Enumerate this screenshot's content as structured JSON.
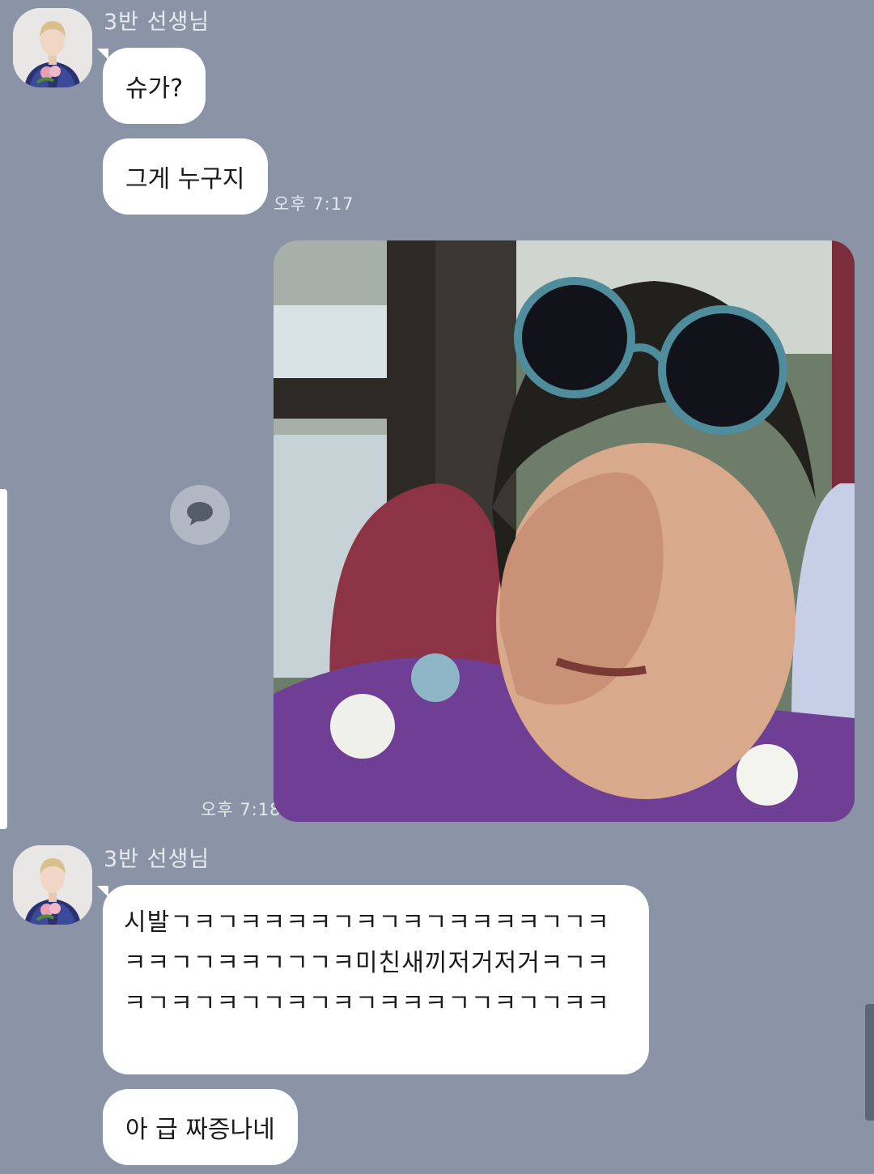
{
  "chat": {
    "messages_group_1": {
      "sender": "3반 선생님",
      "bubble_1": "슈가?",
      "bubble_2": "그게 누구지",
      "time": "오후 7:17"
    },
    "image_message": {
      "time": "오후 7:18",
      "share_icon": "chat-bubble-icon"
    },
    "messages_group_2": {
      "sender": "3반 선생님",
      "bubble_1": "시발ㄱㅋㄱㅋㅋㅋㅋㄱㅋㄱㅋㄱㅋㅋㅋㅋㄱㄱㅋㅋㅋㄱㄱㅋㅋㄱㄱㄱㅋ미친새끼저거저거ㅋㄱㅋㅋㄱㅋㄱㅋㄱㄱㅋㄱㅋㄱㅋㅋㅋㄱㄱㅋㄱㄱㅋㅋ",
      "bubble_2": "아 급 짜증나네"
    }
  },
  "colors": {
    "background": "#8a94a6",
    "bubble": "#ffffff",
    "meta_text": "#e7eaf0"
  }
}
